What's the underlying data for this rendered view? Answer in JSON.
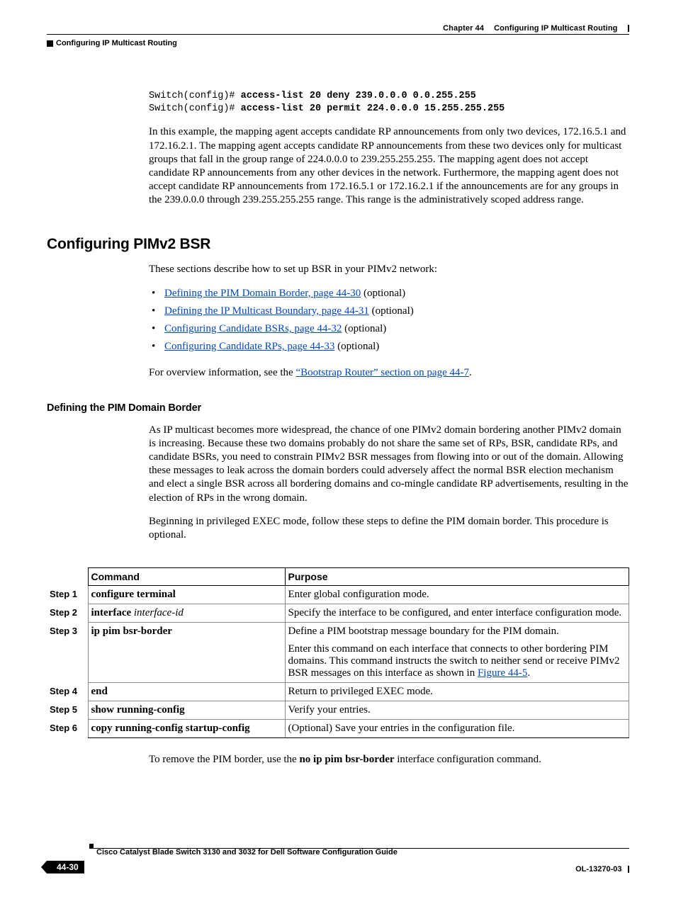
{
  "header": {
    "chapter": "Chapter 44",
    "chapter_title": "Configuring IP Multicast Routing",
    "section_label": "Configuring IP Multicast Routing"
  },
  "code": {
    "l1a": "Switch(config)# ",
    "l1b": "access-list 20 deny 239.0.0.0 0.0.255.255",
    "l2a": "Switch(config)# ",
    "l2b": "access-list 20 permit 224.0.0.0 15.255.255.255"
  },
  "intro_para": "In this example, the mapping agent accepts candidate RP announcements from only two devices, 172.16.5.1 and 172.16.2.1. The mapping agent accepts candidate RP announcements from these two devices only for multicast groups that fall in the group range of 224.0.0.0 to 239.255.255.255. The mapping agent does not accept candidate RP announcements from any other devices in the network. Furthermore, the mapping agent does not accept candidate RP announcements from 172.16.5.1 or 172.16.2.1 if the announcements are for any groups in the 239.0.0.0 through 239.255.255.255 range. This range is the administratively scoped address range.",
  "h2": "Configuring PIMv2 BSR",
  "bsr_intro": "These sections describe how to set up BSR in your PIMv2 network:",
  "bullets": [
    {
      "link": "Defining the PIM Domain Border, page 44-30",
      "tail": " (optional)"
    },
    {
      "link": "Defining the IP Multicast Boundary, page 44-31",
      "tail": " (optional)"
    },
    {
      "link": "Configuring Candidate BSRs, page 44-32",
      "tail": " (optional)"
    },
    {
      "link": "Configuring Candidate RPs, page 44-33",
      "tail": " (optional)"
    }
  ],
  "overview_pre": "For overview information, see the ",
  "overview_link": "“Bootstrap Router” section on page 44-7",
  "overview_post": ".",
  "h3": "Defining the PIM Domain Border",
  "border_para": "As IP multicast becomes more widespread, the chance of one PIMv2 domain bordering another PIMv2 domain is increasing. Because these two domains probably do not share the same set of RPs, BSR, candidate RPs, and candidate BSRs, you need to constrain PIMv2 BSR messages from flowing into or out of the domain. Allowing these messages to leak across the domain borders could adversely affect the normal BSR election mechanism and elect a single BSR across all bordering domains and co-mingle candidate RP advertisements, resulting in the election of RPs in the wrong domain.",
  "exec_para": "Beginning in privileged EXEC mode, follow these steps to define the PIM domain border. This procedure is optional.",
  "table": {
    "head_cmd": "Command",
    "head_purpose": "Purpose",
    "rows": [
      {
        "step": "Step 1",
        "cmd": "configure terminal",
        "ital": "",
        "purpose": "Enter global configuration mode."
      },
      {
        "step": "Step 2",
        "cmd": "interface ",
        "ital": "interface-id",
        "purpose": "Specify the interface to be configured, and enter interface configuration mode."
      },
      {
        "step": "Step 3",
        "cmd": "ip pim bsr-border",
        "ital": "",
        "purpose": "Define a PIM bootstrap message boundary for the PIM domain.",
        "sub_pre": "Enter this command on each interface that connects to other bordering PIM domains. This command instructs the switch to neither send or receive PIMv2 BSR messages on this interface as shown in ",
        "sub_link": "Figure 44-5",
        "sub_post": "."
      },
      {
        "step": "Step 4",
        "cmd": "end",
        "ital": "",
        "purpose": "Return to privileged EXEC mode."
      },
      {
        "step": "Step 5",
        "cmd": "show running-config",
        "ital": "",
        "purpose": "Verify your entries."
      },
      {
        "step": "Step 6",
        "cmd": "copy running-config startup-config",
        "ital": "",
        "purpose": "(Optional) Save your entries in the configuration file."
      }
    ]
  },
  "after_table_pre": "To remove the PIM border, use the ",
  "after_table_bold": "no ip pim bsr-border",
  "after_table_post": " interface configuration command.",
  "footer": {
    "book": "Cisco Catalyst Blade Switch 3130 and 3032 for Dell Software Configuration Guide",
    "page": "44-30",
    "docid": "OL-13270-03"
  }
}
